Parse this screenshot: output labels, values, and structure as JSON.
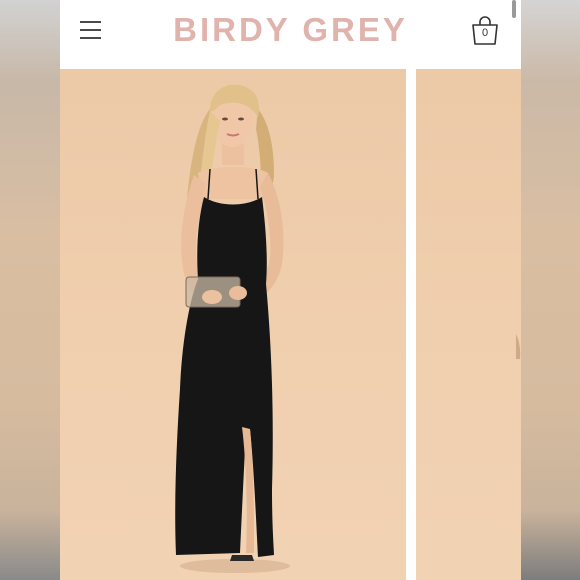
{
  "header": {
    "brand": "BIRDY GREY",
    "cart_count": "0"
  },
  "icons": {
    "menu": "hamburger-menu-icon",
    "cart": "shopping-bag-icon"
  },
  "colors": {
    "brand": "#e0b3ad",
    "backdrop": "#eecdac",
    "dress": "#161616"
  },
  "carousel": {
    "slides": [
      {
        "label": "model-black-dress-front"
      },
      {
        "label": "model-dress-partial"
      }
    ]
  }
}
